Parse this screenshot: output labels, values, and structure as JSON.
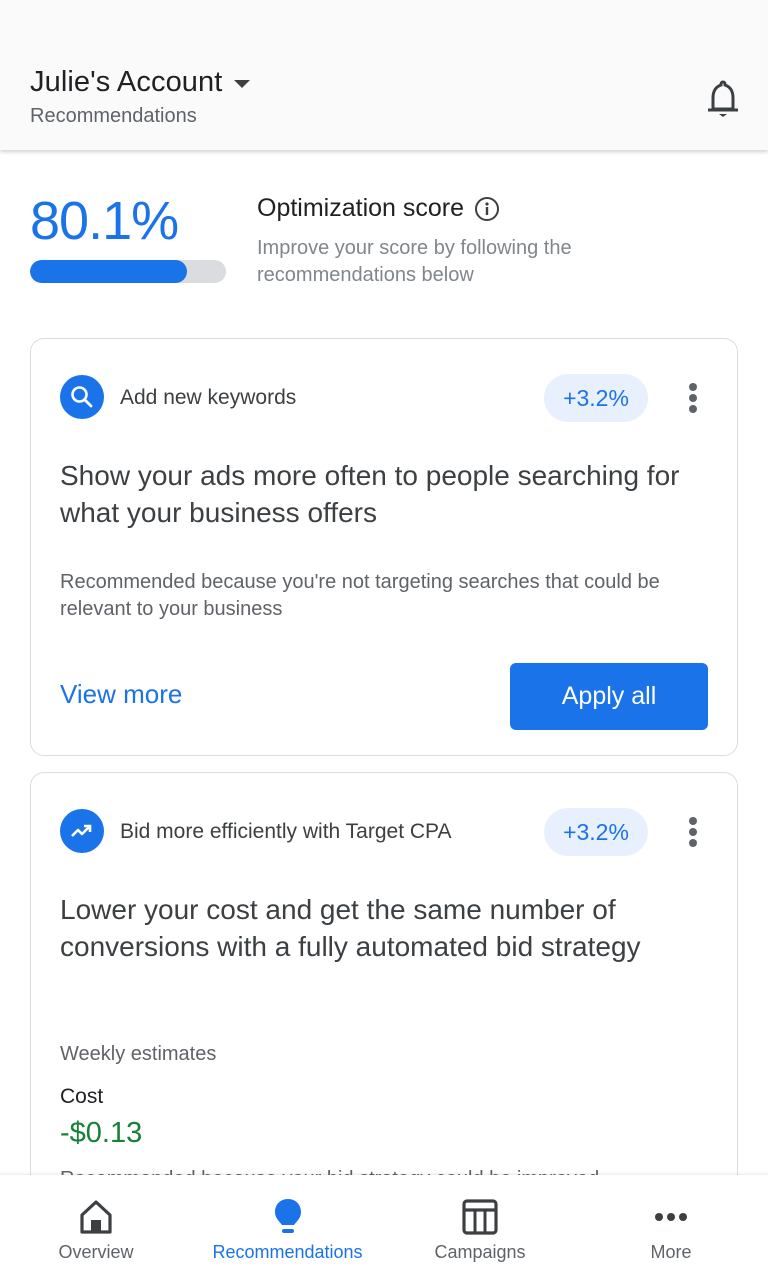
{
  "header": {
    "account_name": "Julie's Account",
    "subtitle": "Recommendations",
    "icons": {
      "account_dropdown": "caret-down-icon",
      "notifications": "bell-icon"
    }
  },
  "optimization": {
    "score_text": "80.1%",
    "score_value_percent": 80.1,
    "title": "Optimization score",
    "info_icon": "info-icon",
    "description": "Improve your score by following the recommendations below"
  },
  "cards": [
    {
      "type_icon": "search-icon",
      "type_label": "Add new keywords",
      "uplift": "+3.2%",
      "title": "Show your ads more often to people searching for what your business offers",
      "reason": "Recommended because you're not targeting searches that could be relevant to your business",
      "view_more_label": "View more",
      "apply_label": "Apply all"
    },
    {
      "type_icon": "trending-up-icon",
      "type_label": "Bid more efficiently with Target CPA",
      "uplift": "+3.2%",
      "title": "Lower your cost and get the same number of conversions with a fully automated bid strategy",
      "estimates_label": "Weekly estimates",
      "cost_label": "Cost",
      "cost_value": "-$0.13",
      "truncated_text": "Recommended because your bid strategy could be improved"
    }
  ],
  "bottom_nav": {
    "items": [
      {
        "label": "Overview",
        "icon": "home-icon",
        "active": false
      },
      {
        "label": "Recommendations",
        "icon": "lightbulb-icon",
        "active": true
      },
      {
        "label": "Campaigns",
        "icon": "table-icon",
        "active": false
      },
      {
        "label": "More",
        "icon": "more-horiz-icon",
        "active": false
      }
    ]
  },
  "colors": {
    "accent": "#1a73e8",
    "positive": "#188038",
    "uplift_bg": "#e8f0fe",
    "text_primary": "#202124",
    "text_secondary": "#5f6368"
  }
}
